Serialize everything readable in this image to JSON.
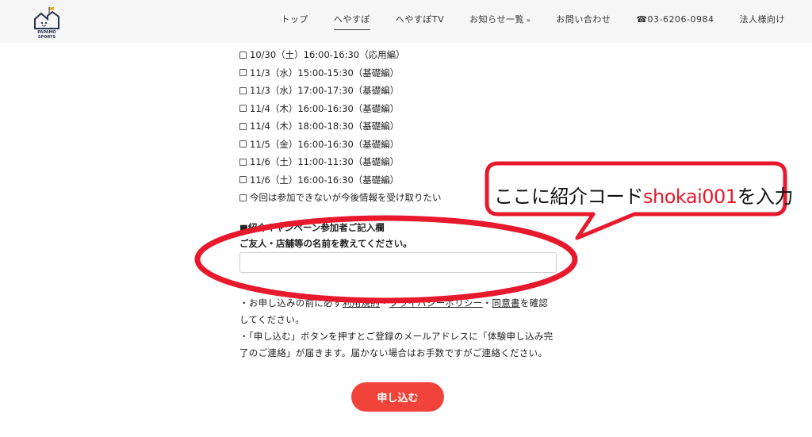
{
  "header": {
    "logo_text": "PAPAMO SPORTS",
    "nav": [
      {
        "label": "トップ",
        "active": false
      },
      {
        "label": "へやすぽ",
        "active": true
      },
      {
        "label": "へやすぽTV",
        "active": false
      },
      {
        "label": "お知らせ一覧",
        "active": false,
        "dropdown": true
      },
      {
        "label": "お問い合わせ",
        "active": false
      },
      {
        "label": "☎03-6206-0984",
        "active": false
      },
      {
        "label": "法人様向け",
        "active": false
      }
    ]
  },
  "schedule_options": [
    "10/30（土）16:00-16:30（応用編）",
    "11/3（水）15:00-15:30（基礎編）",
    "11/3（水）17:00-17:30（基礎編）",
    "11/4（木）16:00-16:30（基礎編）",
    "11/4（木）18:00-18:30（基礎編）",
    "11/5（金）16:00-16:30（基礎編）",
    "11/6（土）11:00-11:30（基礎編）",
    "11/6（土）16:00-16:30（基礎編）",
    "今回は参加できないが今後情報を受け取りたい"
  ],
  "referral": {
    "section_title": "■紹介キャンペーン参加者ご記入欄",
    "label": "ご友人・店舗等の名前を教えてください。",
    "value": ""
  },
  "notes": {
    "line1_a": "・お申し込みの前に必ず",
    "link_terms": "利用規約",
    "sep": "・",
    "link_privacy": "プライバシーポリシー",
    "link_consent": "同意書",
    "line1_b": "を確認してください。",
    "line2": "・「申し込む」ボタンを押すとご登録のメールアドレスに「体験申し込み完了のご連絡」が届きます。届かない場合はお手数ですがご連絡ください。"
  },
  "submit_label": "申し込む",
  "annotation": {
    "text_before": "ここに紹介コード",
    "code": "shokai001",
    "text_after": "を入力",
    "accent_color": "#e8192c"
  }
}
